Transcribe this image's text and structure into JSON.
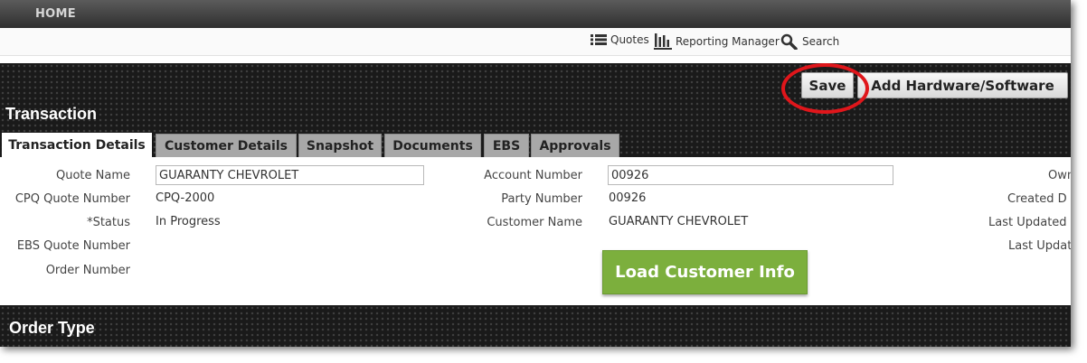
{
  "topnav": {
    "home_label": "HOME"
  },
  "toolbar": {
    "quotes_label": "Quotes",
    "reporting_label": "Reporting Manager",
    "search_label": "Search"
  },
  "actions": {
    "save_label": "Save",
    "add_hardware_label": "Add Hardware/Software"
  },
  "transaction": {
    "title": "Transaction"
  },
  "tabs": [
    {
      "label": "Transaction Details",
      "active": true
    },
    {
      "label": "Customer Details",
      "active": false
    },
    {
      "label": "Snapshot",
      "active": false
    },
    {
      "label": "Documents",
      "active": false
    },
    {
      "label": "EBS",
      "active": false
    },
    {
      "label": "Approvals",
      "active": false
    }
  ],
  "details": {
    "quote_name_label": "Quote Name",
    "quote_name_value": "GUARANTY CHEVROLET",
    "cpq_quote_number_label": "CPQ Quote Number",
    "cpq_quote_number_value": "CPQ-2000",
    "status_label": "*Status",
    "status_value": "In Progress",
    "ebs_quote_number_label": "EBS Quote Number",
    "order_number_label": "Order Number",
    "account_number_label": "Account Number",
    "account_number_value": "00926",
    "party_number_label": "Party Number",
    "party_number_value": "00926",
    "customer_name_label": "Customer Name",
    "customer_name_value": "GUARANTY CHEVROLET",
    "load_customer_label": "Load Customer Info",
    "owner_label_partial": "Own",
    "created_label_partial": "Created D",
    "last_updated_label_partial": "Last Updated",
    "last_updated2_label_partial": "Last Updat"
  },
  "order_type": {
    "title": "Order Type"
  },
  "colors": {
    "accent_red_ring": "#e0161b",
    "load_button_green": "#7caf3d"
  }
}
